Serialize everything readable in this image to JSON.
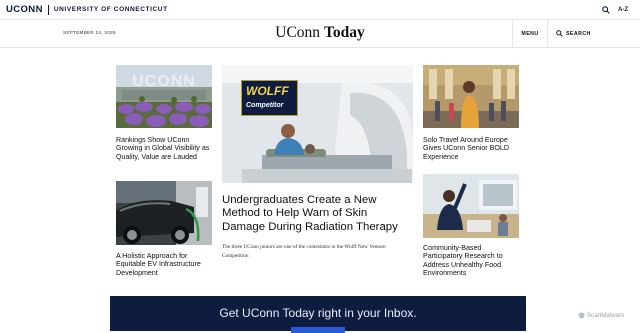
{
  "header": {
    "logo": "UCONN",
    "university": "UNIVERSITY OF CONNECTICUT",
    "az": "A-Z"
  },
  "masthead": {
    "date": "SEPTEMBER 24, 2026",
    "title_a": "UConn",
    "title_b": "Today",
    "menu": "MENU",
    "search": "SEARCH"
  },
  "stories": {
    "left_top": {
      "title": "Rankings Show UConn Growing in Global Visibility as Quality, Value are Lauded",
      "image_text": "UCONN"
    },
    "left_bottom": {
      "title": "A Holistic Approach for Equitable EV Infrastructure Development"
    },
    "feature": {
      "title": "Undergraduates Create a New Method to Help Warn of Skin Damage During Radiation Therapy",
      "subtitle": "The three UConn juniors are one of the contestants in the Wolff New Venture Competition",
      "poster_line1": "WOLFF",
      "poster_line2": "Competitor"
    },
    "right_top": {
      "title": "Solo Travel Around Europe Gives UConn Senior BOLD Experience"
    },
    "right_bottom": {
      "title": "Community-Based Participatory Research to Address Unhealthy Food Environments"
    }
  },
  "newsletter": {
    "text": "Get UConn Today right in your Inbox."
  },
  "watermark": {
    "text": "ScanMalware"
  },
  "colors": {
    "navy": "#0e1c3f",
    "brand": "#0b1a3a",
    "button": "#2a5bd7"
  }
}
